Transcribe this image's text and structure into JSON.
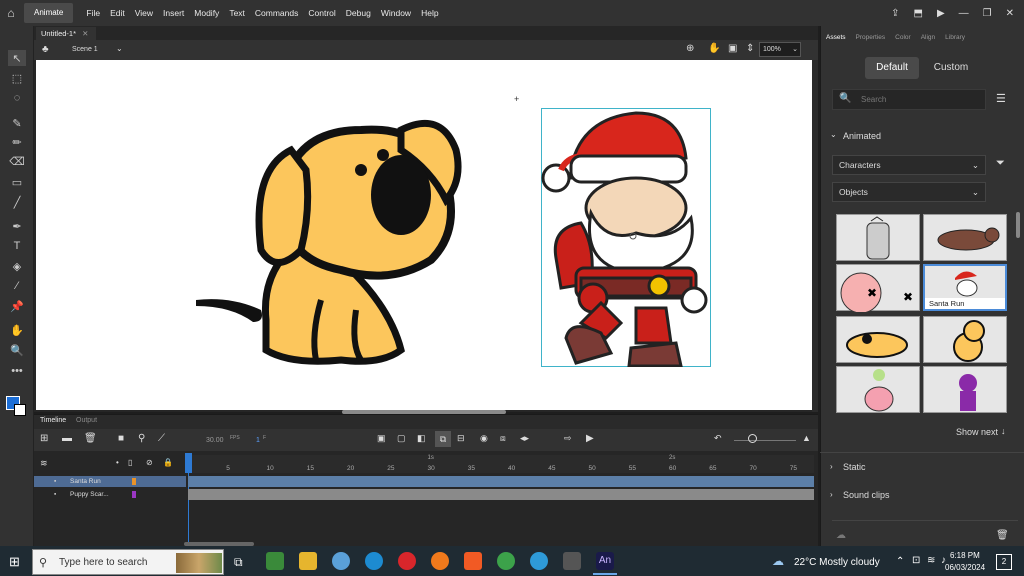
{
  "menubar": {
    "app_name": "Animate",
    "items": [
      "File",
      "Edit",
      "View",
      "Insert",
      "Modify",
      "Text",
      "Commands",
      "Control",
      "Debug",
      "Window",
      "Help"
    ]
  },
  "document": {
    "tab_title": "Untitled-1*",
    "scene": "Scene 1",
    "zoom": "100%"
  },
  "timeline": {
    "tabs": [
      "Timeline",
      "Output"
    ],
    "fps": "30.00",
    "fps_unit": "FPS",
    "frame": "1",
    "frame_unit": "F",
    "ruler_ticks": [
      "5",
      "10",
      "15",
      "20",
      "25",
      "30",
      "35",
      "40",
      "45",
      "50",
      "55",
      "60",
      "65",
      "70",
      "75"
    ],
    "time_markers": [
      "1s",
      "2s"
    ],
    "layers": [
      {
        "name": "Santa Run",
        "color": "#e8932a"
      },
      {
        "name": "Puppy Scar...",
        "color": "#9b37c4"
      }
    ]
  },
  "panel": {
    "tabs": [
      "Assets",
      "Properties",
      "Color",
      "Align",
      "Library"
    ],
    "toggle": [
      "Default",
      "Custom"
    ],
    "search_placeholder": "Search",
    "animated_label": "Animated",
    "category": "Characters",
    "subcategory": "Objects",
    "selected_caption": "Santa Run",
    "show_next": "Show next",
    "sections": [
      "Static",
      "Sound clips"
    ]
  },
  "taskbar": {
    "search_placeholder": "Type here to search",
    "weather": "22°C  Mostly cloudy",
    "time": "6:18 PM",
    "date": "06/03/2024",
    "notifications": "2"
  },
  "colors": {
    "accent": "#4b8bd8",
    "panel_bg": "#323232",
    "stage_bg": "#ffffff",
    "layer_selected": "#4e6b94"
  }
}
